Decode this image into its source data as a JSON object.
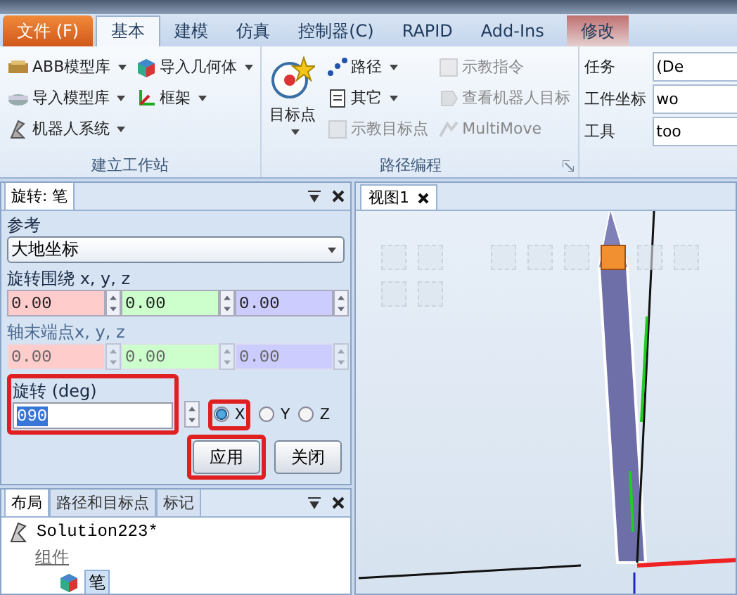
{
  "ribbon": {
    "tabs": [
      {
        "label": "文件 (F)",
        "kind": "file",
        "selected": false
      },
      {
        "label": "基本",
        "kind": "tab",
        "selected": true
      },
      {
        "label": "建模",
        "kind": "tab",
        "selected": false
      },
      {
        "label": "仿真",
        "kind": "tab",
        "selected": false
      },
      {
        "label": "控制器(C)",
        "kind": "tab",
        "selected": false
      },
      {
        "label": "RAPID",
        "kind": "tab",
        "selected": false
      },
      {
        "label": "Add-Ins",
        "kind": "tab",
        "selected": false
      },
      {
        "label": "修改",
        "kind": "context",
        "selected": false
      }
    ],
    "groups": [
      {
        "title": "建立工作站",
        "launcher": false,
        "columns": [
          [
            {
              "label": "ABB模型库",
              "dropdown": true,
              "disabled": false
            },
            {
              "label": "导入模型库",
              "dropdown": true,
              "disabled": false
            },
            {
              "label": "机器人系统",
              "dropdown": true,
              "disabled": false
            }
          ],
          [
            {
              "label": "导入几何体",
              "dropdown": true,
              "disabled": false
            },
            {
              "label": "框架",
              "dropdown": true,
              "disabled": false
            }
          ]
        ]
      },
      {
        "title": "路径编程",
        "launcher": true,
        "big": {
          "label": "目标点",
          "dropdown": true
        },
        "columns": [
          [
            {
              "label": "路径",
              "dropdown": true,
              "disabled": false
            },
            {
              "label": "其它",
              "dropdown": true,
              "disabled": false
            },
            {
              "label": "示教目标点",
              "dropdown": false,
              "disabled": true
            }
          ],
          [
            {
              "label": "示教指令",
              "dropdown": false,
              "disabled": true
            },
            {
              "label": "查看机器人目标",
              "dropdown": false,
              "disabled": true
            },
            {
              "label": "MultiMove",
              "dropdown": false,
              "disabled": true
            }
          ]
        ]
      }
    ],
    "fields": [
      {
        "label": "任务",
        "value": "(De"
      },
      {
        "label": "工件坐标",
        "value": "wo"
      },
      {
        "label": "工具",
        "value": "too"
      }
    ]
  },
  "rotate_panel": {
    "tab": "旋转: 笔",
    "reference": {
      "label": "参考",
      "value": "大地坐标"
    },
    "groups": [
      {
        "label": "旋转围绕 x, y, z",
        "disabled": false,
        "fields": [
          {
            "value": "0.00",
            "color": "#ffcccc"
          },
          {
            "value": "0.00",
            "color": "#ccffcc"
          },
          {
            "value": "0.00",
            "color": "#ccccff"
          }
        ]
      },
      {
        "label": "轴末端点x, y, z",
        "disabled": true,
        "fields": [
          {
            "value": "0.00",
            "color": "#ffcccc"
          },
          {
            "value": "0.00",
            "color": "#ccffcc"
          },
          {
            "value": "0.00",
            "color": "#ccccff"
          }
        ]
      }
    ],
    "angle": {
      "label": "旋转 (deg)",
      "value": "090",
      "highlighted": true
    },
    "axes": {
      "highlighted": true,
      "options": [
        {
          "label": "X",
          "selected": true
        },
        {
          "label": "Y",
          "selected": false
        },
        {
          "label": "Z",
          "selected": false
        }
      ]
    },
    "buttons": [
      {
        "label": "应用",
        "highlighted": true
      },
      {
        "label": "关闭",
        "highlighted": false
      }
    ]
  },
  "layout_panel": {
    "tabs": [
      {
        "label": "布局",
        "selected": true
      },
      {
        "label": "路径和目标点",
        "selected": false
      },
      {
        "label": "标记",
        "selected": false
      }
    ],
    "tree": [
      {
        "label": "Solution223*",
        "selected": false,
        "children": [
          {
            "label": "组件",
            "selected": false,
            "children": [
              {
                "label": "笔",
                "selected": true
              }
            ]
          }
        ]
      }
    ]
  },
  "view": {
    "tab": "视图1"
  }
}
